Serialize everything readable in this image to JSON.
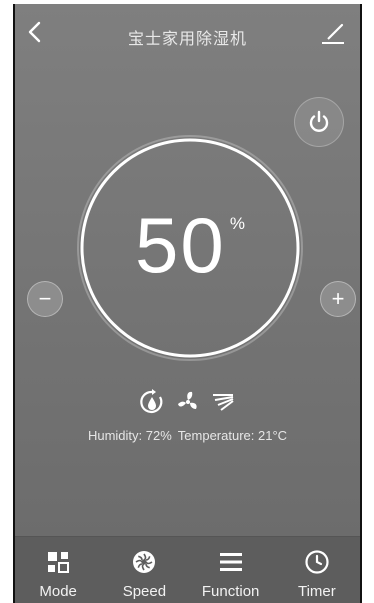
{
  "header": {
    "title": "宝士家用除湿机",
    "back_icon": "chevron-left-icon",
    "edit_icon": "edit-icon"
  },
  "power": {
    "icon": "power-icon"
  },
  "dial": {
    "value": "50",
    "unit": "%"
  },
  "controls": {
    "minus_label": "−",
    "plus_label": "+"
  },
  "mode_icons": [
    "dehumidify-mode-icon",
    "fan-speed-icon",
    "swing-icon"
  ],
  "status": {
    "humidity": "Humidity: 72%",
    "temperature": "Temperature: 21°C"
  },
  "toolbar": {
    "items": [
      {
        "label": "Mode",
        "icon": "mode-icon"
      },
      {
        "label": "Speed",
        "icon": "fan-icon"
      },
      {
        "label": "Function",
        "icon": "menu-icon"
      },
      {
        "label": "Timer",
        "icon": "clock-icon"
      }
    ]
  },
  "colors": {
    "background": "#7a7a7a",
    "toolbar": "#5d5d5d",
    "text": "#ffffff"
  }
}
